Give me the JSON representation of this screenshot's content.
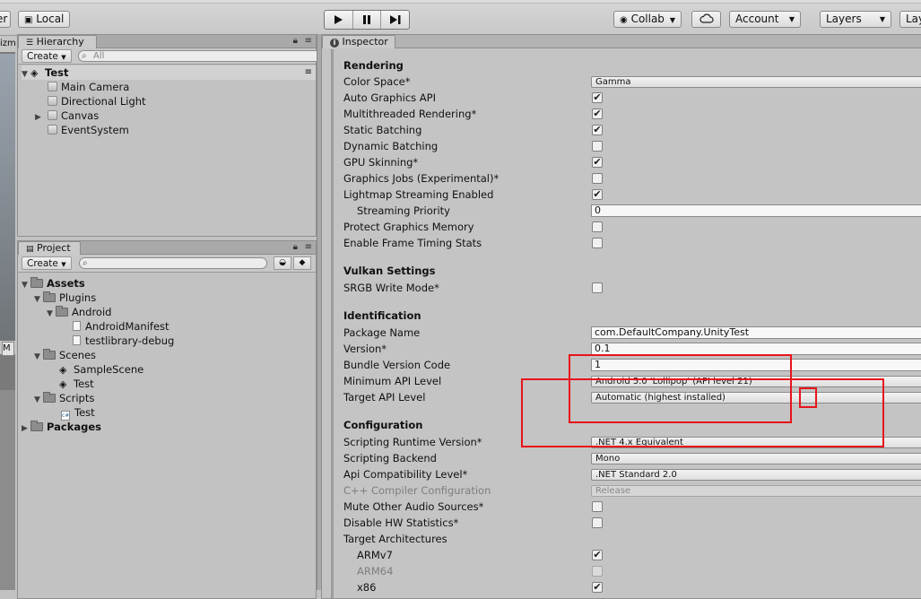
{
  "toolbar": {
    "left_stub": "er",
    "local_label": "Local",
    "collab_label": "Collab",
    "account_label": "Account",
    "layers_label": "Layers",
    "layout_stub": "Lay"
  },
  "scene_stub": {
    "zoom_stub": "izm",
    "m_stub": "M"
  },
  "hierarchy": {
    "tab": "Hierarchy",
    "create": "Create",
    "search_placeholder": "All",
    "scene": "Test",
    "items": [
      "Main Camera",
      "Directional Light",
      "Canvas",
      "EventSystem"
    ]
  },
  "project": {
    "tab": "Project",
    "create": "Create",
    "tree": {
      "assets": "Assets",
      "plugins": "Plugins",
      "android": "Android",
      "manifest": "AndroidManifest",
      "library": "testlibrary-debug",
      "scenes": "Scenes",
      "sample_scene": "SampleScene",
      "test_scene": "Test",
      "scripts": "Scripts",
      "test_script": "Test",
      "packages": "Packages"
    }
  },
  "inspector": {
    "tab": "Inspector",
    "rendering": {
      "header": "Rendering",
      "color_space": {
        "label": "Color Space*",
        "value": "Gamma"
      },
      "auto_graphics_api": {
        "label": "Auto Graphics API",
        "checked": true
      },
      "multithreaded": {
        "label": "Multithreaded Rendering*",
        "checked": true
      },
      "static_batching": {
        "label": "Static Batching",
        "checked": true
      },
      "dynamic_batching": {
        "label": "Dynamic Batching",
        "checked": false
      },
      "gpu_skinning": {
        "label": "GPU Skinning*",
        "checked": true
      },
      "graphics_jobs": {
        "label": "Graphics Jobs (Experimental)*",
        "checked": false
      },
      "lightmap_streaming": {
        "label": "Lightmap Streaming Enabled",
        "checked": true
      },
      "streaming_priority": {
        "label": "Streaming Priority",
        "value": "0"
      },
      "protect_memory": {
        "label": "Protect Graphics Memory",
        "checked": false
      },
      "frame_timing": {
        "label": "Enable Frame Timing Stats",
        "checked": false
      }
    },
    "vulkan": {
      "header": "Vulkan Settings",
      "srgb": {
        "label": "SRGB Write Mode*",
        "checked": false
      }
    },
    "identification": {
      "header": "Identification",
      "package_name": {
        "label": "Package Name",
        "value": "com.DefaultCompany.UnityTest"
      },
      "version": {
        "label": "Version*",
        "value": "0.1"
      },
      "bundle_code": {
        "label": "Bundle Version Code",
        "value": "1"
      },
      "min_api": {
        "label": "Minimum API Level",
        "value": "Android 5.0 'Lollipop' (API level 21)"
      },
      "target_api": {
        "label": "Target API Level",
        "value": "Automatic (highest installed)"
      }
    },
    "configuration": {
      "header": "Configuration",
      "runtime": {
        "label": "Scripting Runtime Version*",
        "value": ".NET 4.x Equivalent"
      },
      "backend": {
        "label": "Scripting Backend",
        "value": "Mono"
      },
      "api_compat": {
        "label": "Api Compatibility Level*",
        "value": ".NET Standard 2.0"
      },
      "cpp_config": {
        "label": "C++ Compiler Configuration",
        "value": "Release"
      },
      "mute_audio": {
        "label": "Mute Other Audio Sources*",
        "checked": false
      },
      "disable_hw": {
        "label": "Disable HW Statistics*",
        "checked": false
      },
      "target_arch": {
        "label": "Target Architectures"
      },
      "armv7": {
        "label": "ARMv7",
        "checked": true
      },
      "arm64": {
        "label": "ARM64",
        "checked": false
      },
      "x86": {
        "label": "x86",
        "checked": true
      }
    }
  },
  "colors": {
    "annotation_red": "#e8141b",
    "panel_bg": "#c2c2c2"
  }
}
